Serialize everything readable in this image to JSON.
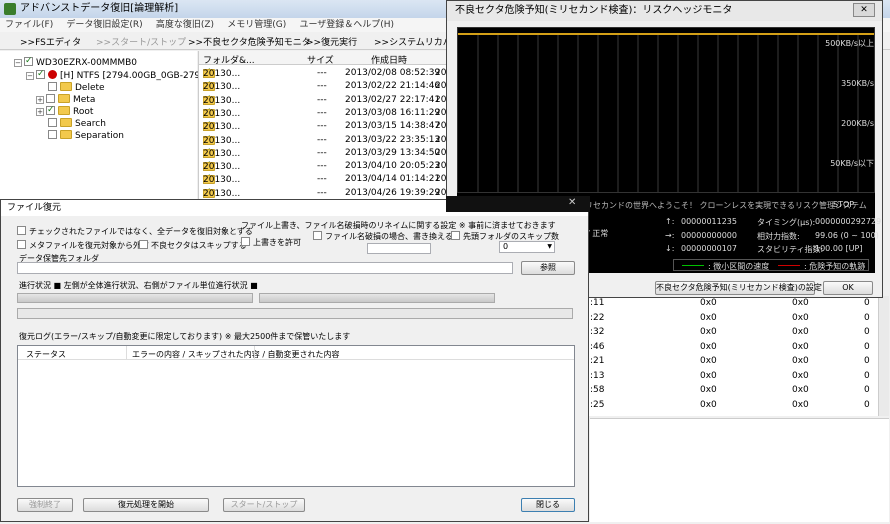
{
  "main_window": {
    "title": "アドバンストデータ復旧[論理解析]",
    "menu": [
      "ファイル(F)",
      "データ復旧設定(R)",
      "高度な復旧(Z)",
      "メモリ管理(G)",
      "ユーザ登録＆ヘルプ(H)"
    ],
    "toolbar": {
      "fs_editor": ">>FSエディタ",
      "start_stop": ">>スタート/ストップ",
      "bad_sector_monitor": ">>不良セクタ危険予知モニタ",
      "recover": ">>復元実行",
      "system_recovery": ">>システムリカバリ"
    },
    "tree": {
      "disk": "WD30EZRX-00MMMB0",
      "volume": "[H] NTFS [2794.00GB_0GB-2794GB]",
      "folders": [
        "Delete",
        "Meta",
        "Root",
        "Search",
        "Separation"
      ]
    },
    "grid": {
      "columns": [
        "フォルダ&...",
        "サイズ",
        "作成日時"
      ],
      "rows": [
        {
          "name": "20130...",
          "size": "---",
          "created": "2013/02/08 08:52:39",
          "extra": "201"
        },
        {
          "name": "20130...",
          "size": "---",
          "created": "2013/02/22 21:14:46",
          "extra": "201"
        },
        {
          "name": "20130...",
          "size": "---",
          "created": "2013/02/27 22:17:41",
          "extra": "201"
        },
        {
          "name": "20130...",
          "size": "---",
          "created": "2013/03/08 16:11:29",
          "extra": "201"
        },
        {
          "name": "20130...",
          "size": "---",
          "created": "2013/03/15 14:38:47",
          "extra": "201"
        },
        {
          "name": "20130...",
          "size": "---",
          "created": "2013/03/22 23:35:13",
          "extra": "201"
        },
        {
          "name": "20130...",
          "size": "---",
          "created": "2013/03/29 13:34:50",
          "extra": "201"
        },
        {
          "name": "20130...",
          "size": "---",
          "created": "2013/04/10 20:05:23",
          "extra": "201"
        },
        {
          "name": "20130...",
          "size": "---",
          "created": "2013/04/14 01:14:21",
          "extra": "201"
        },
        {
          "name": "20130...",
          "size": "---",
          "created": "2013/04/26 19:39:29",
          "extra": "201"
        }
      ]
    },
    "right_rows": [
      {
        "time": ":11",
        "a": "0x0",
        "b": "0x0",
        "c": "0"
      },
      {
        "time": ":22",
        "a": "0x0",
        "b": "0x0",
        "c": "0"
      },
      {
        "time": ":32",
        "a": "0x0",
        "b": "0x0",
        "c": "0"
      },
      {
        "time": ":46",
        "a": "0x0",
        "b": "0x0",
        "c": "0"
      },
      {
        "time": ":21",
        "a": "0x0",
        "b": "0x0",
        "c": "0"
      },
      {
        "time": ":13",
        "a": "0x0",
        "b": "0x0",
        "c": "0"
      },
      {
        "time": ":58",
        "a": "0x0",
        "b": "0x0",
        "c": "0"
      },
      {
        "time": ":25",
        "a": "0x0",
        "b": "0x0",
        "c": "0"
      }
    ]
  },
  "monitor": {
    "title": "不良セクタ危険予知(ミリセカンド検査)：リスクヘッジモニタ",
    "y_labels": [
      "500KB/s以上",
      "350KB/s",
      "200KB/s",
      "50KB/s以下"
    ],
    "welcome": "リセカンドの世界へようこそ！ クローンレスを実現できるリスク管理システム",
    "stop": "STOP",
    "normal": "/ 正常",
    "counters": [
      {
        "arrow": "↑:",
        "value": "00000011235"
      },
      {
        "arrow": "→:",
        "value": "00000000000"
      },
      {
        "arrow": "↓:",
        "value": "00000000107"
      }
    ],
    "metrics": [
      {
        "label": "タイミング(μs):",
        "value": "0000000292729"
      },
      {
        "label": "相対力指数:",
        "value": "99.06 (0 ~ 100)"
      },
      {
        "label": "スタビリティ指数:",
        "value": "100.00 [UP]"
      }
    ],
    "legend": {
      "green": ": 微小区間の速度",
      "red": ": 危険予知の軌跡"
    },
    "settings_button": "不良セクタ危険予知(ミリセカンド検査)の設定",
    "ok_button": "OK",
    "colors": {
      "bg": "#000000",
      "grid": "#3a3a3a",
      "top_line": "#d4a017",
      "green": "#00c000",
      "red": "#d00000"
    }
  },
  "dialog": {
    "title": "ファイル復元",
    "opt_all": "チェックされたファイルではなく、全データを復旧対象とする",
    "opt_meta": "メタファイルを復元対象から外す",
    "opt_skip_bad": "不良セクタはスキップする",
    "overwrite_heading": "ファイル上書き、ファイル名破損時のリネイムに関する設定 ※ 事前に済ませておきます",
    "opt_overwrite": "上書きを許可",
    "opt_rename": "ファイル名破損の場合、書き換える",
    "opt_skip_folder": "先頭フォルダのスキップ数",
    "skip_value": "0",
    "dest_label": "データ保管先フォルダ",
    "browse_button": "参照",
    "progress_label": "進行状況 ■ 左側が全体進行状況、右側がファイル単位進行状況 ■",
    "log_label": "復元ログ(エラー/スキップ/自動変更に限定しております) ※ 最大2500件まで保管いたします",
    "log_columns": [
      "ステータス",
      "エラーの内容 / スキップされた内容 / 自動変更された内容"
    ],
    "force_end_button": "強制終了",
    "start_button": "復元処理を開始",
    "start_stop_button": "スタート/ストップ",
    "close_button": "閉じる"
  }
}
